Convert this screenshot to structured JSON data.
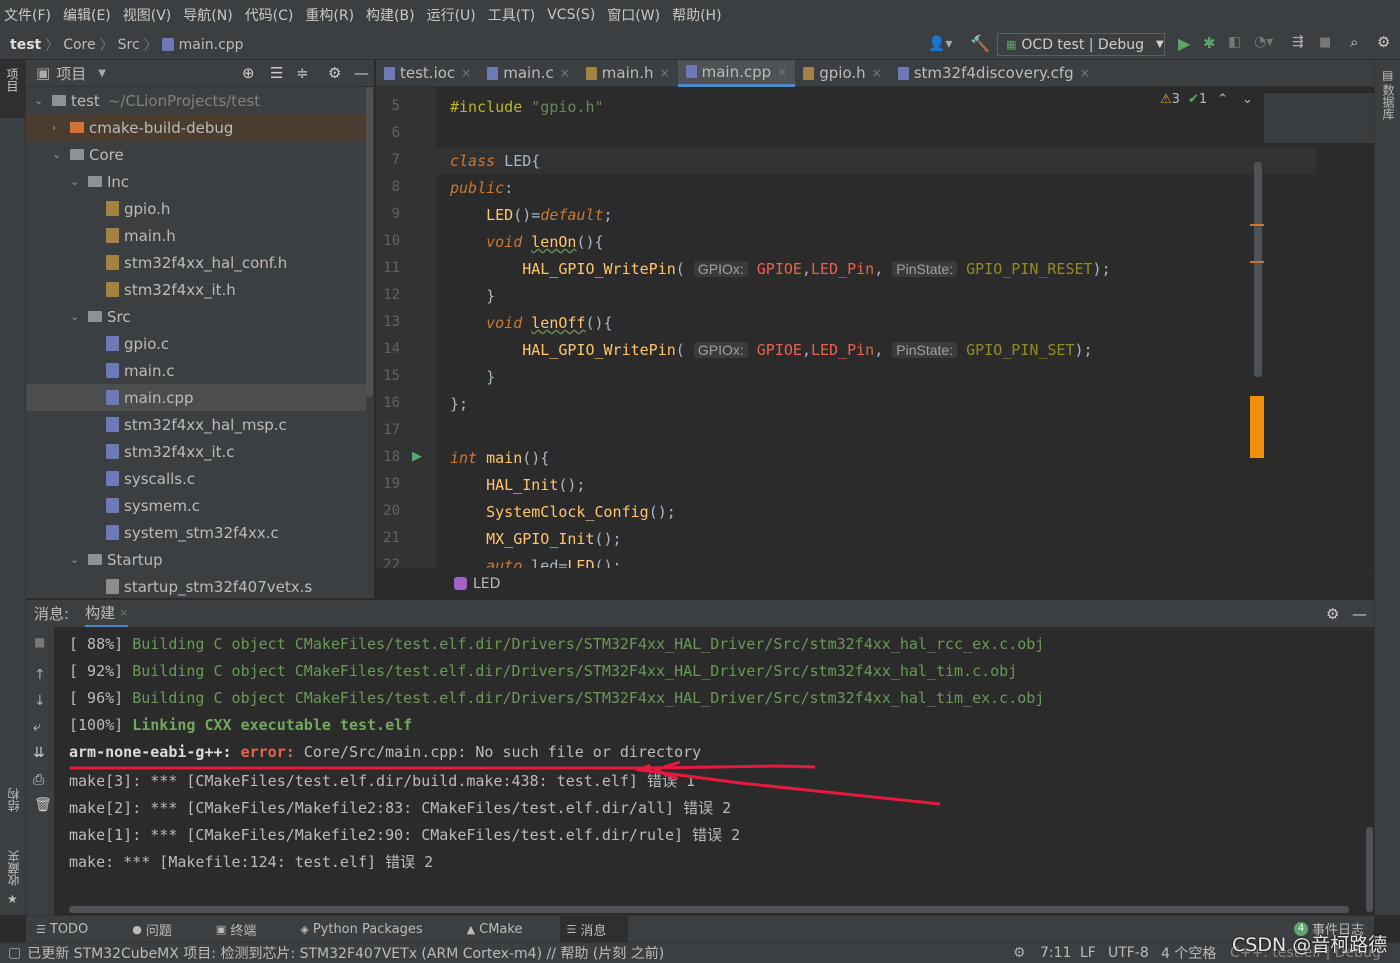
{
  "menu": [
    "文件(F)",
    "编辑(E)",
    "视图(V)",
    "导航(N)",
    "代码(C)",
    "重构(R)",
    "构建(B)",
    "运行(U)",
    "工具(T)",
    "VCS(S)",
    "窗口(W)",
    "帮助(H)"
  ],
  "breadcrumb": [
    "test",
    "Core",
    "Src",
    "main.cpp"
  ],
  "run_config": "OCD test | Debug",
  "project": {
    "title": "项目",
    "tree": [
      {
        "label": "test",
        "extra": "~/CLionProjects/test",
        "kind": "folder",
        "depth": 0,
        "open": true
      },
      {
        "label": "cmake-build-debug",
        "kind": "folder-orange",
        "depth": 1,
        "open": false
      },
      {
        "label": "Core",
        "kind": "folder",
        "depth": 1,
        "open": true
      },
      {
        "label": "Inc",
        "kind": "folder",
        "depth": 2,
        "open": true
      },
      {
        "label": "gpio.h",
        "kind": "h",
        "depth": 3
      },
      {
        "label": "main.h",
        "kind": "h",
        "depth": 3
      },
      {
        "label": "stm32f4xx_hal_conf.h",
        "kind": "h",
        "depth": 3
      },
      {
        "label": "stm32f4xx_it.h",
        "kind": "h",
        "depth": 3
      },
      {
        "label": "Src",
        "kind": "folder",
        "depth": 2,
        "open": true
      },
      {
        "label": "gpio.c",
        "kind": "c",
        "depth": 3
      },
      {
        "label": "main.c",
        "kind": "c",
        "depth": 3
      },
      {
        "label": "main.cpp",
        "kind": "cpp",
        "depth": 3,
        "selected": true
      },
      {
        "label": "stm32f4xx_hal_msp.c",
        "kind": "c",
        "depth": 3
      },
      {
        "label": "stm32f4xx_it.c",
        "kind": "c",
        "depth": 3
      },
      {
        "label": "syscalls.c",
        "kind": "c",
        "depth": 3
      },
      {
        "label": "sysmem.c",
        "kind": "c",
        "depth": 3
      },
      {
        "label": "system_stm32f4xx.c",
        "kind": "c",
        "depth": 3
      },
      {
        "label": "Startup",
        "kind": "folder",
        "depth": 2,
        "open": true
      },
      {
        "label": "startup_stm32f407vetx.s",
        "kind": "s",
        "depth": 3
      }
    ]
  },
  "tabs": [
    {
      "label": "test.ioc",
      "active": false
    },
    {
      "label": "main.c",
      "active": false
    },
    {
      "label": "main.h",
      "active": false
    },
    {
      "label": "main.cpp",
      "active": true
    },
    {
      "label": "gpio.h",
      "active": false
    },
    {
      "label": "stm32f4discovery.cfg",
      "active": false
    }
  ],
  "editor": {
    "warnings": "3",
    "checks": "1",
    "line_numbers": [
      "5",
      "6",
      "7",
      "8",
      "9",
      "10",
      "11",
      "12",
      "13",
      "14",
      "15",
      "16",
      "17",
      "18",
      "19",
      "20",
      "21",
      "22"
    ],
    "breadcrumb": "LED",
    "hint_gpiox": "GPIOx:",
    "hint_pinstate": "PinState:"
  },
  "messages": {
    "label": "消息:",
    "tab": "构建",
    "lines": [
      {
        "pre": "[ 88%] ",
        "body": "Building C object CMakeFiles/test.elf.dir/Drivers/STM32F4xx_HAL_Driver/Src/stm32f4xx_hal_rcc_ex.c.obj",
        "style": "g"
      },
      {
        "pre": "[ 92%] ",
        "body": "Building C object CMakeFiles/test.elf.dir/Drivers/STM32F4xx_HAL_Driver/Src/stm32f4xx_hal_tim.c.obj",
        "style": "g"
      },
      {
        "pre": "[ 96%] ",
        "body": "Building C object CMakeFiles/test.elf.dir/Drivers/STM32F4xx_HAL_Driver/Src/stm32f4xx_hal_tim_ex.c.obj",
        "style": "g"
      },
      {
        "pre": "[100%] ",
        "body": "Linking CXX executable test.elf",
        "style": "gb"
      },
      {
        "pre": "arm-none-eabi-g++: ",
        "err": "error:",
        "body": " Core/Src/main.cpp: No such file or directory",
        "style": "err"
      },
      {
        "pre": "make[3]: *** [CMakeFiles/test.elf.dir/build.make:438: test.elf] 错误 1",
        "style": "plain"
      },
      {
        "pre": "make[2]: *** [CMakeFiles/Makefile2:83: CMakeFiles/test.elf.dir/all] 错误 2",
        "style": "plain"
      },
      {
        "pre": "make[1]: *** [CMakeFiles/Makefile2:90: CMakeFiles/test.elf.dir/rule] 错误 2",
        "style": "plain"
      },
      {
        "pre": "make: *** [Makefile:124: test.elf] 错误 2",
        "style": "plain"
      }
    ]
  },
  "toolwindows": [
    "TODO",
    "问题",
    "终端",
    "Python Packages",
    "CMake",
    "消息"
  ],
  "left_strip": [
    "项目",
    "结构",
    "收藏夹"
  ],
  "right_strip": [
    "数据库"
  ],
  "event_log": "事件日志",
  "event_count": "4",
  "status": {
    "text": "已更新 STM32CubeMX 项目: 检测到芯片: STM32F407VETx (ARM Cortex-m4) // 帮助 (片刻 之前)",
    "position": "7:11",
    "line_sep": "LF",
    "encoding": "UTF-8",
    "indent": "4 个空格",
    "context": "C++: test.elf | Debug"
  },
  "watermark": "CSDN @音柯路德",
  "colors": {
    "accent": "#4a88c7",
    "error": "#e8624f",
    "annotation": "#e8193c"
  }
}
